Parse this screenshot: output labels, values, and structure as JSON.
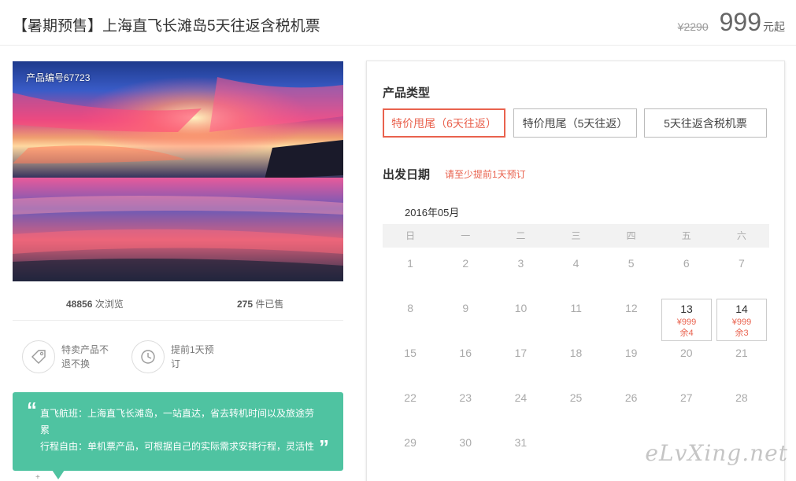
{
  "header": {
    "title": "【暑期预售】上海直飞长滩岛5天往返含税机票",
    "old_price": "¥2290",
    "price": "999",
    "price_suffix": "元起"
  },
  "photo": {
    "code": "产品编号67723"
  },
  "stats": {
    "views_num": "48856",
    "views_label": " 次浏览",
    "sold_num": "275",
    "sold_label": " 件已售"
  },
  "features": [
    {
      "text": "特卖产品不退不换",
      "icon": "tag-icon"
    },
    {
      "text": "提前1天预订",
      "icon": "clock-icon"
    }
  ],
  "highlights": {
    "line1": "直飞航班：上海直飞长滩岛，一站直达，省去转机时间以及旅途劳累",
    "line2": "行程自由：单机票产品，可根据自己的实际需求安排行程，灵活性"
  },
  "colors": {
    "accent": "#e9624e",
    "green": "#4fc3a1"
  },
  "booking": {
    "type_label": "产品类型",
    "types": [
      "特价甩尾（6天往返）",
      "特价甩尾（5天往返）",
      "5天往返含税机票"
    ],
    "selected_type_index": 0,
    "date_label": "出发日期",
    "date_hint": "请至少提前1天预订",
    "month": "2016年05月",
    "weekdays": [
      "日",
      "一",
      "二",
      "三",
      "四",
      "五",
      "六"
    ],
    "weeks": [
      [
        "1",
        "2",
        "3",
        "4",
        "5",
        "6",
        "7"
      ],
      [
        "8",
        "9",
        "10",
        "11",
        "12",
        "13",
        "14"
      ],
      [
        "15",
        "16",
        "17",
        "18",
        "19",
        "20",
        "21"
      ],
      [
        "22",
        "23",
        "24",
        "25",
        "26",
        "27",
        "28"
      ],
      [
        "29",
        "30",
        "31",
        "",
        "",
        "",
        ""
      ]
    ],
    "available": {
      "13": {
        "price": "¥999",
        "left": "余4"
      },
      "14": {
        "price": "¥999",
        "left": "余3"
      }
    }
  },
  "watermark": "eLvXing.net"
}
